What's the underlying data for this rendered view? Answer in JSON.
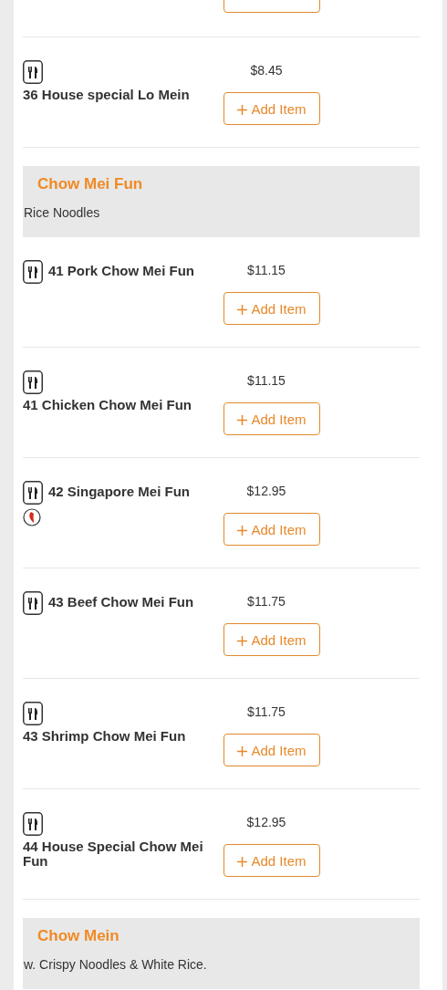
{
  "sections": [
    {
      "items": [
        {
          "name": "36 House special Lo Mein",
          "price": "$8.45",
          "spicy": false,
          "button": "Add Item"
        }
      ]
    },
    {
      "title": "Chow Mei Fun",
      "description": "Rice Noodles",
      "items": [
        {
          "name": "41 Pork Chow Mei Fun",
          "price": "$11.15",
          "spicy": false,
          "button": "Add Item"
        },
        {
          "name": "41 Chicken Chow Mei Fun",
          "price": "$11.15",
          "spicy": false,
          "button": "Add Item"
        },
        {
          "name": "42 Singapore Mei Fun",
          "price": "$12.95",
          "spicy": true,
          "button": "Add Item"
        },
        {
          "name": "43 Beef Chow Mei Fun",
          "price": "$11.75",
          "spicy": false,
          "button": "Add Item"
        },
        {
          "name": "43 Shrimp Chow Mei Fun",
          "price": "$11.75",
          "spicy": false,
          "button": "Add Item"
        },
        {
          "name": "44 House Special Chow Mei Fun",
          "price": "$12.95",
          "spicy": false,
          "button": "Add Item"
        }
      ]
    },
    {
      "title": "Chow Mein",
      "description": "w. Crispy Noodles & White Rice."
    }
  ]
}
